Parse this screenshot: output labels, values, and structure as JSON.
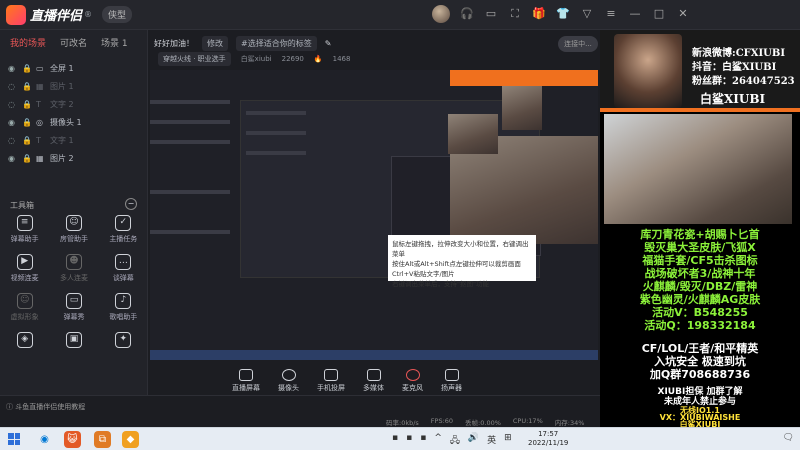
{
  "app": {
    "title": "直播伴侣",
    "badge": "®",
    "mode": "侠型"
  },
  "titlebar": {
    "icons": [
      "headset-icon",
      "wallet-icon",
      "fullscreen-icon",
      "gift-icon",
      "shirt-icon",
      "filter-icon",
      "menu-icon",
      "minimize-icon",
      "maximize-icon",
      "close-icon"
    ]
  },
  "left": {
    "tabs": [
      "我的场景",
      "可改名",
      "场景 1"
    ],
    "sources": [
      {
        "label": "全屏 1",
        "dim": false
      },
      {
        "label": "图片 1",
        "dim": true
      },
      {
        "label": "文字 2",
        "dim": true
      },
      {
        "label": "摄像头 1",
        "dim": false
      },
      {
        "label": "文字 1",
        "dim": true
      },
      {
        "label": "图片 2",
        "dim": false
      }
    ],
    "tools_title": "工具箱",
    "tools": [
      {
        "label": "弹幕助手",
        "icon": "💬",
        "dim": false
      },
      {
        "label": "房管助手",
        "icon": "👤",
        "dim": false
      },
      {
        "label": "主播任务",
        "icon": "☑",
        "dim": false
      },
      {
        "label": "视频连麦",
        "icon": "📹",
        "dim": false
      },
      {
        "label": "多人连麦",
        "icon": "👥",
        "dim": true
      },
      {
        "label": "谈弹幕",
        "icon": "💭",
        "dim": false
      },
      {
        "label": "虚拟形象",
        "icon": "☺",
        "dim": true
      },
      {
        "label": "弹幕秀",
        "icon": "📺",
        "dim": false
      },
      {
        "label": "歌唱助手",
        "icon": "♪",
        "dim": false
      },
      {
        "label": "",
        "icon": "🎮",
        "dim": false
      },
      {
        "label": "",
        "icon": "▣",
        "dim": false
      },
      {
        "label": "",
        "icon": "✦",
        "dim": false
      }
    ]
  },
  "center": {
    "greeting": "好好加油！",
    "edit_label": "修改",
    "tag_placeholder": "#选择适合你的标签",
    "category": "穿越火线 · 职业选手",
    "user": "白鲨xiubi",
    "followers": "22690",
    "likes": "1468",
    "tooltip": [
      "鼠标左键拖拽，拉伸改变大小和位置，右键调出菜单",
      "按住Alt或Alt+Shift点左键拉伸可以裁剪画面",
      "Ctrl+V粘贴文字/图片",
      "右键调出菜单后，支持\"抠图\"功能"
    ],
    "bottom": [
      {
        "label": "直播屏幕",
        "icon": "screen-icon"
      },
      {
        "label": "摄像头",
        "icon": "camera-icon"
      },
      {
        "label": "手机投屏",
        "icon": "phone-cast-icon"
      },
      {
        "label": "多媒体",
        "icon": "media-icon"
      },
      {
        "label": "麦克风",
        "icon": "microphone-icon"
      },
      {
        "label": "扬声器",
        "icon": "speaker-icon"
      }
    ],
    "golive": "连接中..."
  },
  "overlay": {
    "weibo": "新浪微博:CFXIUBI",
    "douyin": "抖音：白鲨XIUBI",
    "fans": "粉丝群：264047523",
    "name": "白鲨XIUBI",
    "green_lines": [
      "库刀青花瓷+胡赐卜匕首",
      "毁灭巢大圣皮肤/飞狐X",
      "福猫手套/CF5击杀图标",
      "战场破坏者3/战神十年",
      "火麒麟/毁灭/DBZ/雷神",
      "紫色幽灵/火麒麟AG皮肤",
      "活动V：B548255",
      "活动Q：198332184"
    ],
    "white_lines": [
      "CF/LOL/王者/和平精英",
      "入坑安全  极速到坑",
      "加Q群708688736",
      "XIUBI担保  加群了解",
      "未成年人禁止参与"
    ],
    "yellow_lines": [
      "无线IO1.1",
      "VX：XIUBIWAISHE",
      "白鲨XIUBI"
    ]
  },
  "status": {
    "link": "斗鱼直播伴侣使用教程",
    "bitrate": "码率:0kb/s",
    "fps": "FPS:60",
    "dropped": "丢帧:0.00%",
    "cpu": "CPU:17%",
    "mem": "内存:34%"
  },
  "taskbar": {
    "time": "17:57",
    "date": "2022/11/19",
    "ime": "英",
    "apps": [
      {
        "c": "#e35a27",
        "g": "😺"
      },
      {
        "c": "#e07b25",
        "g": "⧉"
      },
      {
        "c": "#f0a020",
        "g": "◆"
      },
      {
        "c": "#e06820",
        "g": "◆"
      }
    ]
  }
}
